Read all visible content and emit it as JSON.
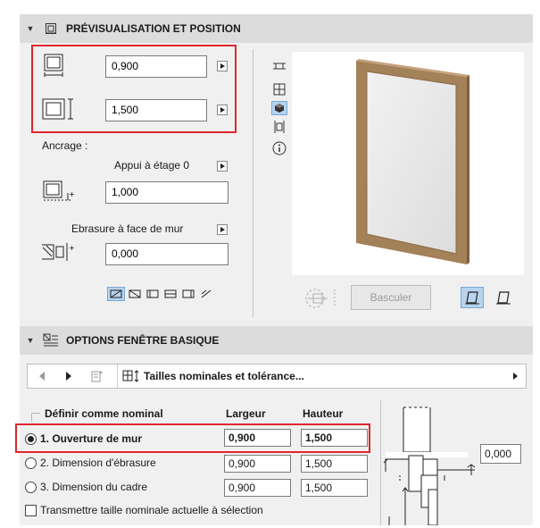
{
  "section1": {
    "title": "PRÉVISUALISATION ET POSITION",
    "width_value": "0,900",
    "height_value": "1,500",
    "anchor_label": "Ancrage :",
    "anchor_mode": "Appui à étage 0",
    "anchor_value": "1,000",
    "reveal_mode": "Ebrasure à face de mur",
    "reveal_value": "0,000",
    "flip_button": "Basculer"
  },
  "section2": {
    "title": "OPTIONS FENÊTRE BASIQUE",
    "dropdown_label": "Tailles nominales et tolérance...",
    "group_label": "Définir comme nominal",
    "col_width": "Largeur",
    "col_height": "Hauteur",
    "rows": [
      {
        "label": "1. Ouverture de mur",
        "width": "0,900",
        "height": "1,500",
        "checked": true
      },
      {
        "label": "2. Dimension d'ébrasure",
        "width": "0,900",
        "height": "1,500",
        "checked": false
      },
      {
        "label": "3. Dimension du cadre",
        "width": "0,900",
        "height": "1,500",
        "checked": false
      }
    ],
    "transfer_label": "Transmettre taille nominale actuelle à sélection",
    "diagram_value": "0,000"
  },
  "colors": {
    "highlight": "#e0262c",
    "frame": "#9c7b57",
    "active_icon": "#b7d3ee"
  }
}
